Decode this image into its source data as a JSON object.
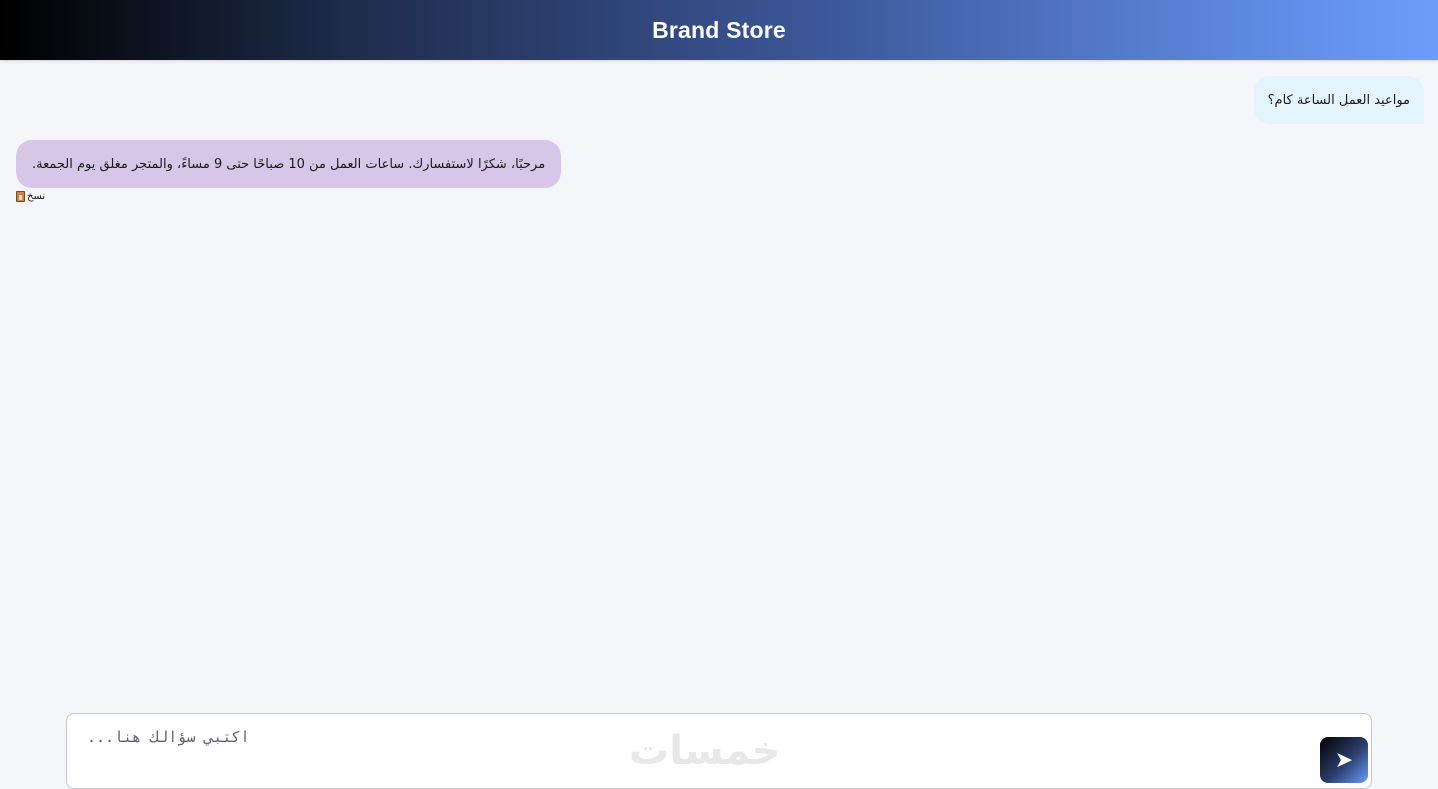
{
  "header": {
    "title": "Brand Store"
  },
  "chat": {
    "messages": [
      {
        "role": "user",
        "text": "مواعيد العمل الساعة كام؟"
      },
      {
        "role": "bot",
        "text": "مرحبًا، شكرًا لاستفسارك. ساعات العمل من 10 صباحًا حتى 9 مساءً، والمتجر مغلق يوم الجمعة."
      }
    ],
    "copy_label": "نسخ",
    "copy_icon": "clipboard-icon"
  },
  "composer": {
    "placeholder": "...اكتبي سؤالك هنا",
    "watermark": "خمسات",
    "send_icon": "send-arrow-icon"
  },
  "colors": {
    "header_gradient_start": "#000000",
    "header_gradient_end": "#6c9dfb",
    "user_bubble": "#e3f4fd",
    "bot_bubble": "#d6c7e8",
    "background": "#f4f6fa"
  }
}
